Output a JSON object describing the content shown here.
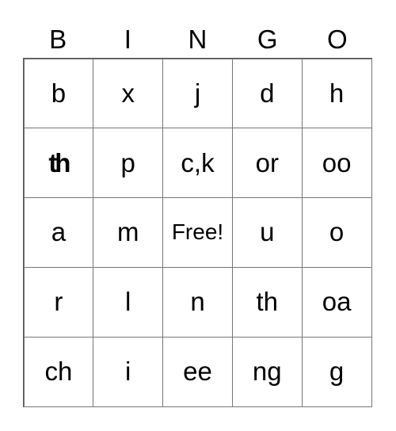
{
  "header": [
    "B",
    "I",
    "N",
    "G",
    "O"
  ],
  "rows": [
    [
      "b",
      "x",
      "j",
      "d",
      "h"
    ],
    [
      "th",
      "p",
      "c,k",
      "or",
      "oo"
    ],
    [
      "a",
      "m",
      "Free!",
      "u",
      "o"
    ],
    [
      "r",
      "l",
      "n",
      "th",
      "oa"
    ],
    [
      "ch",
      "i",
      "ee",
      "ng",
      "g"
    ]
  ]
}
